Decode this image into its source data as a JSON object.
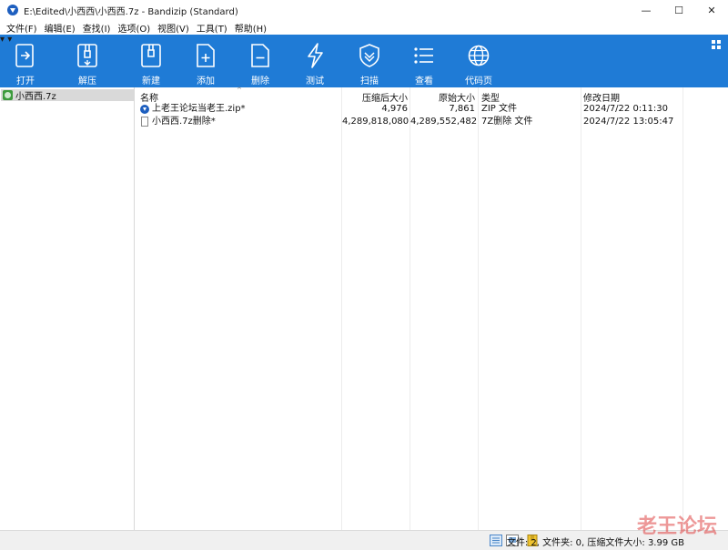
{
  "window": {
    "title": "E:\\Edited\\小西西\\小西西.7z - Bandizip (Standard)",
    "controls": {
      "minimize": "—",
      "maximize": "☐",
      "close": "✕"
    }
  },
  "menu": [
    "文件(F)",
    "编辑(E)",
    "查找(I)",
    "选项(O)",
    "视图(V)",
    "工具(T)",
    "帮助(H)"
  ],
  "toolbar": {
    "open_label": "打开",
    "extract_label": "解压",
    "new_label": "新建",
    "add_label": "添加",
    "delete_label": "删除",
    "test_label": "测试",
    "scan_label": "扫描",
    "view_label": "查看",
    "codepage_label": "代码页"
  },
  "tree": {
    "root_label": "小西西.7z"
  },
  "columns": {
    "name": "名称",
    "packed": "压缩后大小",
    "size": "原始大小",
    "type": "类型",
    "modified": "修改日期"
  },
  "files": [
    {
      "name": "上老王论坛当老王.zip*",
      "packed": "4,976",
      "size": "7,861",
      "type": "ZIP 文件",
      "modified": "2024/7/22 0:11:30",
      "icon": "zip-icon"
    },
    {
      "name": "小西西.7z删除*",
      "packed": "4,289,818,080",
      "size": "4,289,552,482",
      "type": "7Z删除 文件",
      "modified": "2024/7/22 13:05:47",
      "icon": "file-icon"
    }
  ],
  "status": {
    "text": "文件: 2, 文件夹: 0, 压缩文件大小: 3.99 GB"
  },
  "watermark": "老王论坛",
  "colors": {
    "toolbar": "#1f7bd6",
    "selection": "#d9d9d9"
  }
}
